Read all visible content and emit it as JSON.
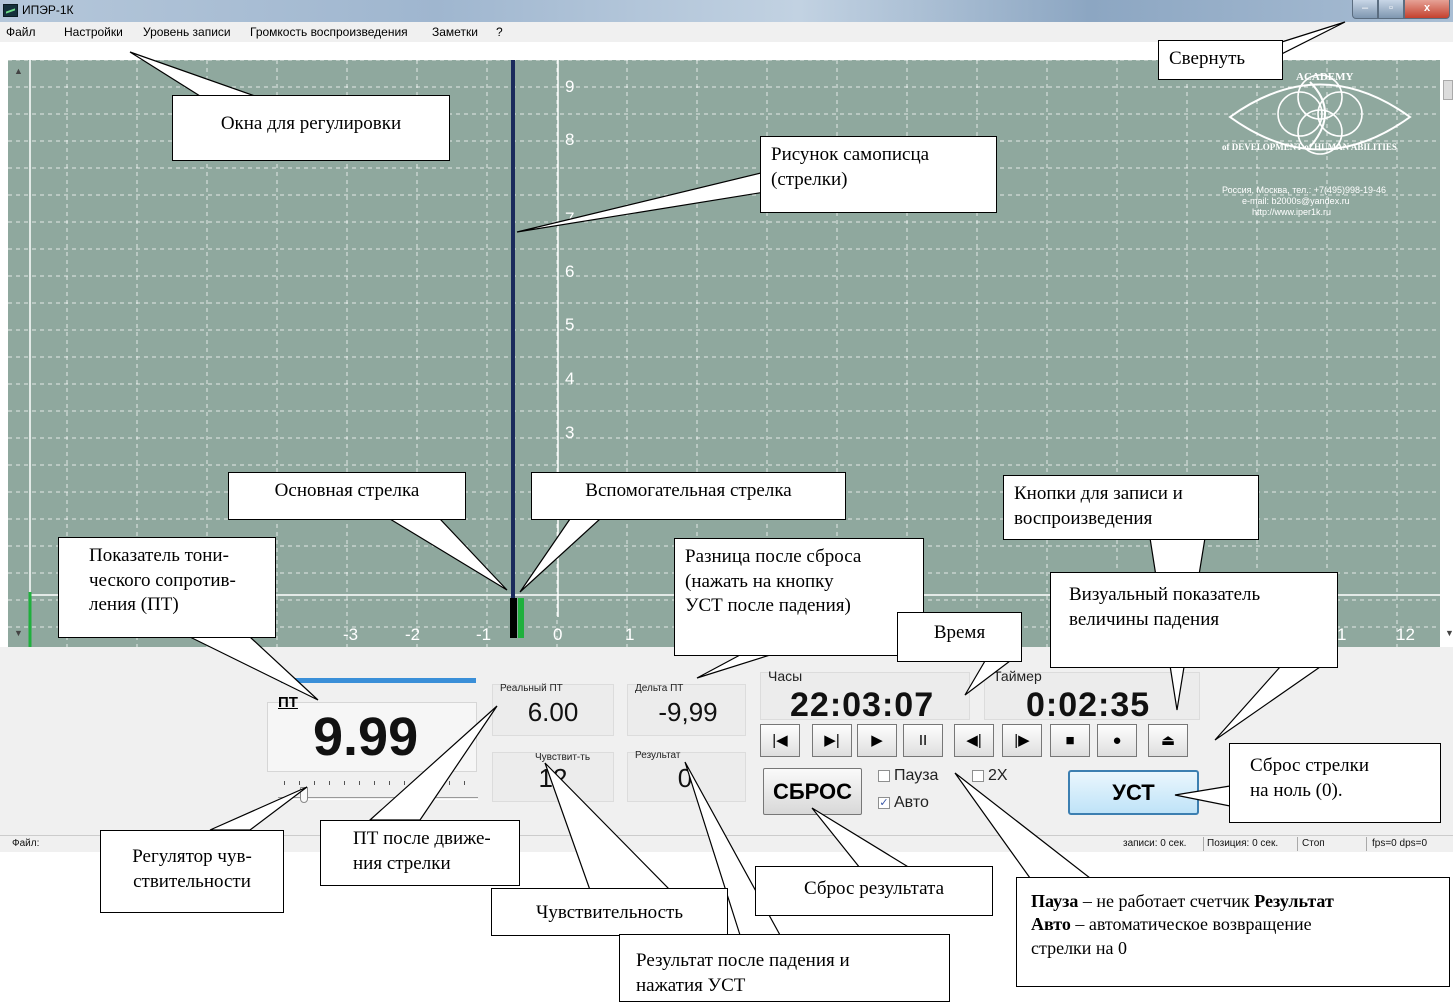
{
  "window": {
    "title": "ИПЭР-1К",
    "min": "‒",
    "max": "▫",
    "close": "x"
  },
  "menu": [
    "Файл",
    "Настройки",
    "Уровень записи",
    "Громкость воспроизведения",
    "Заметки",
    "?"
  ],
  "chart": {
    "x_ticks": [
      "-3",
      "-2",
      "-1",
      "0",
      "1",
      "1",
      "12"
    ],
    "y_ticks": [
      "9",
      "8",
      "7",
      "6",
      "5",
      "4",
      "3"
    ],
    "colors": {
      "background": "#8fa89e",
      "grid": "#ffffff",
      "main_needle": "#1a2a5c",
      "aux_needle": "#1fb03d"
    }
  },
  "logo": {
    "top_text": "ACADEMY",
    "ring_text": "of DEVELOPMENT of HUMAN ABILITIES",
    "line1": "Россия, Москва, тел.: +7(495)998-19-46",
    "line2": "e-mail: b2000s@yandex.ru",
    "line3": "http://www.iper1k.ru"
  },
  "panel": {
    "pt_label": "ПТ",
    "pt_value": "9.99",
    "real_pt_label": "Реальный ПТ",
    "real_pt_value": "6.00",
    "delta_label": "Дельта ПТ",
    "delta_value": "-9,99",
    "sens_label": "Чувствит-ть",
    "sens_value": "12",
    "result_label": "Результат",
    "result_value": "0",
    "clock_label": "Часы",
    "clock_value": "22:03:07",
    "timer_label": "Таймер",
    "timer_value": "0:02:35",
    "reset_label": "СБРОС",
    "ust_label": "УСТ",
    "pause_label": "Пауза",
    "auto_label": "Авто",
    "x2_label": "2X",
    "pause_checked": false,
    "auto_checked": true,
    "x2_checked": false,
    "media_buttons": [
      "|◀",
      "▶|",
      "▶",
      "II",
      "◀|",
      "|▶",
      "■",
      "●",
      "⏏"
    ]
  },
  "status": {
    "file": "Файл:",
    "record": "записи: 0 сек.",
    "position": "Позиция: 0 сек.",
    "state": "Стоп",
    "fps": "fps=0 dps=0"
  },
  "callouts": {
    "collapse": "Свернуть",
    "adjust_windows": "Окна для регулировки",
    "recorder_line1": "Рисунок самописца",
    "recorder_line2": "(стрелки)",
    "main_needle": "Основная стрелка",
    "aux_needle": "Вспомогательная  стрелка",
    "buttons_line1": "Кнопки для записи и",
    "buttons_line2": "воспроизведения",
    "pt_line1": "Показатель тони-",
    "pt_line2": "ческого сопротив-",
    "pt_line3": "ления (ПТ)",
    "diff_line1": "Разница после сброса",
    "diff_line2": "(нажать на кнопку",
    "diff_line3": "УСТ после падения)",
    "time": "Время",
    "visual_line1": "Визуальный показатель",
    "visual_line2": "величины падения",
    "reset_needle_line1": "Сброс стрелки",
    "reset_needle_line2": "на ноль (0).",
    "sens_reg_line1": "Регулятор чув-",
    "sens_reg_line2": "ствительности",
    "pt_after_line1": "ПТ после движе-",
    "pt_after_line2": "ния стрелки",
    "sensitivity": "Чувствительность",
    "reset_result": "Сброс результата",
    "result_after_line1": "Результат после падения и",
    "result_after_line2": "нажатия УСТ",
    "pause_bold": "Пауза",
    "pause_rest": " – не работает счетчик ",
    "pause_bold2": "Результат",
    "auto_bold": "Авто",
    "auto_rest": " – автоматическое возвращение",
    "auto_line2": "стрелки на 0"
  }
}
